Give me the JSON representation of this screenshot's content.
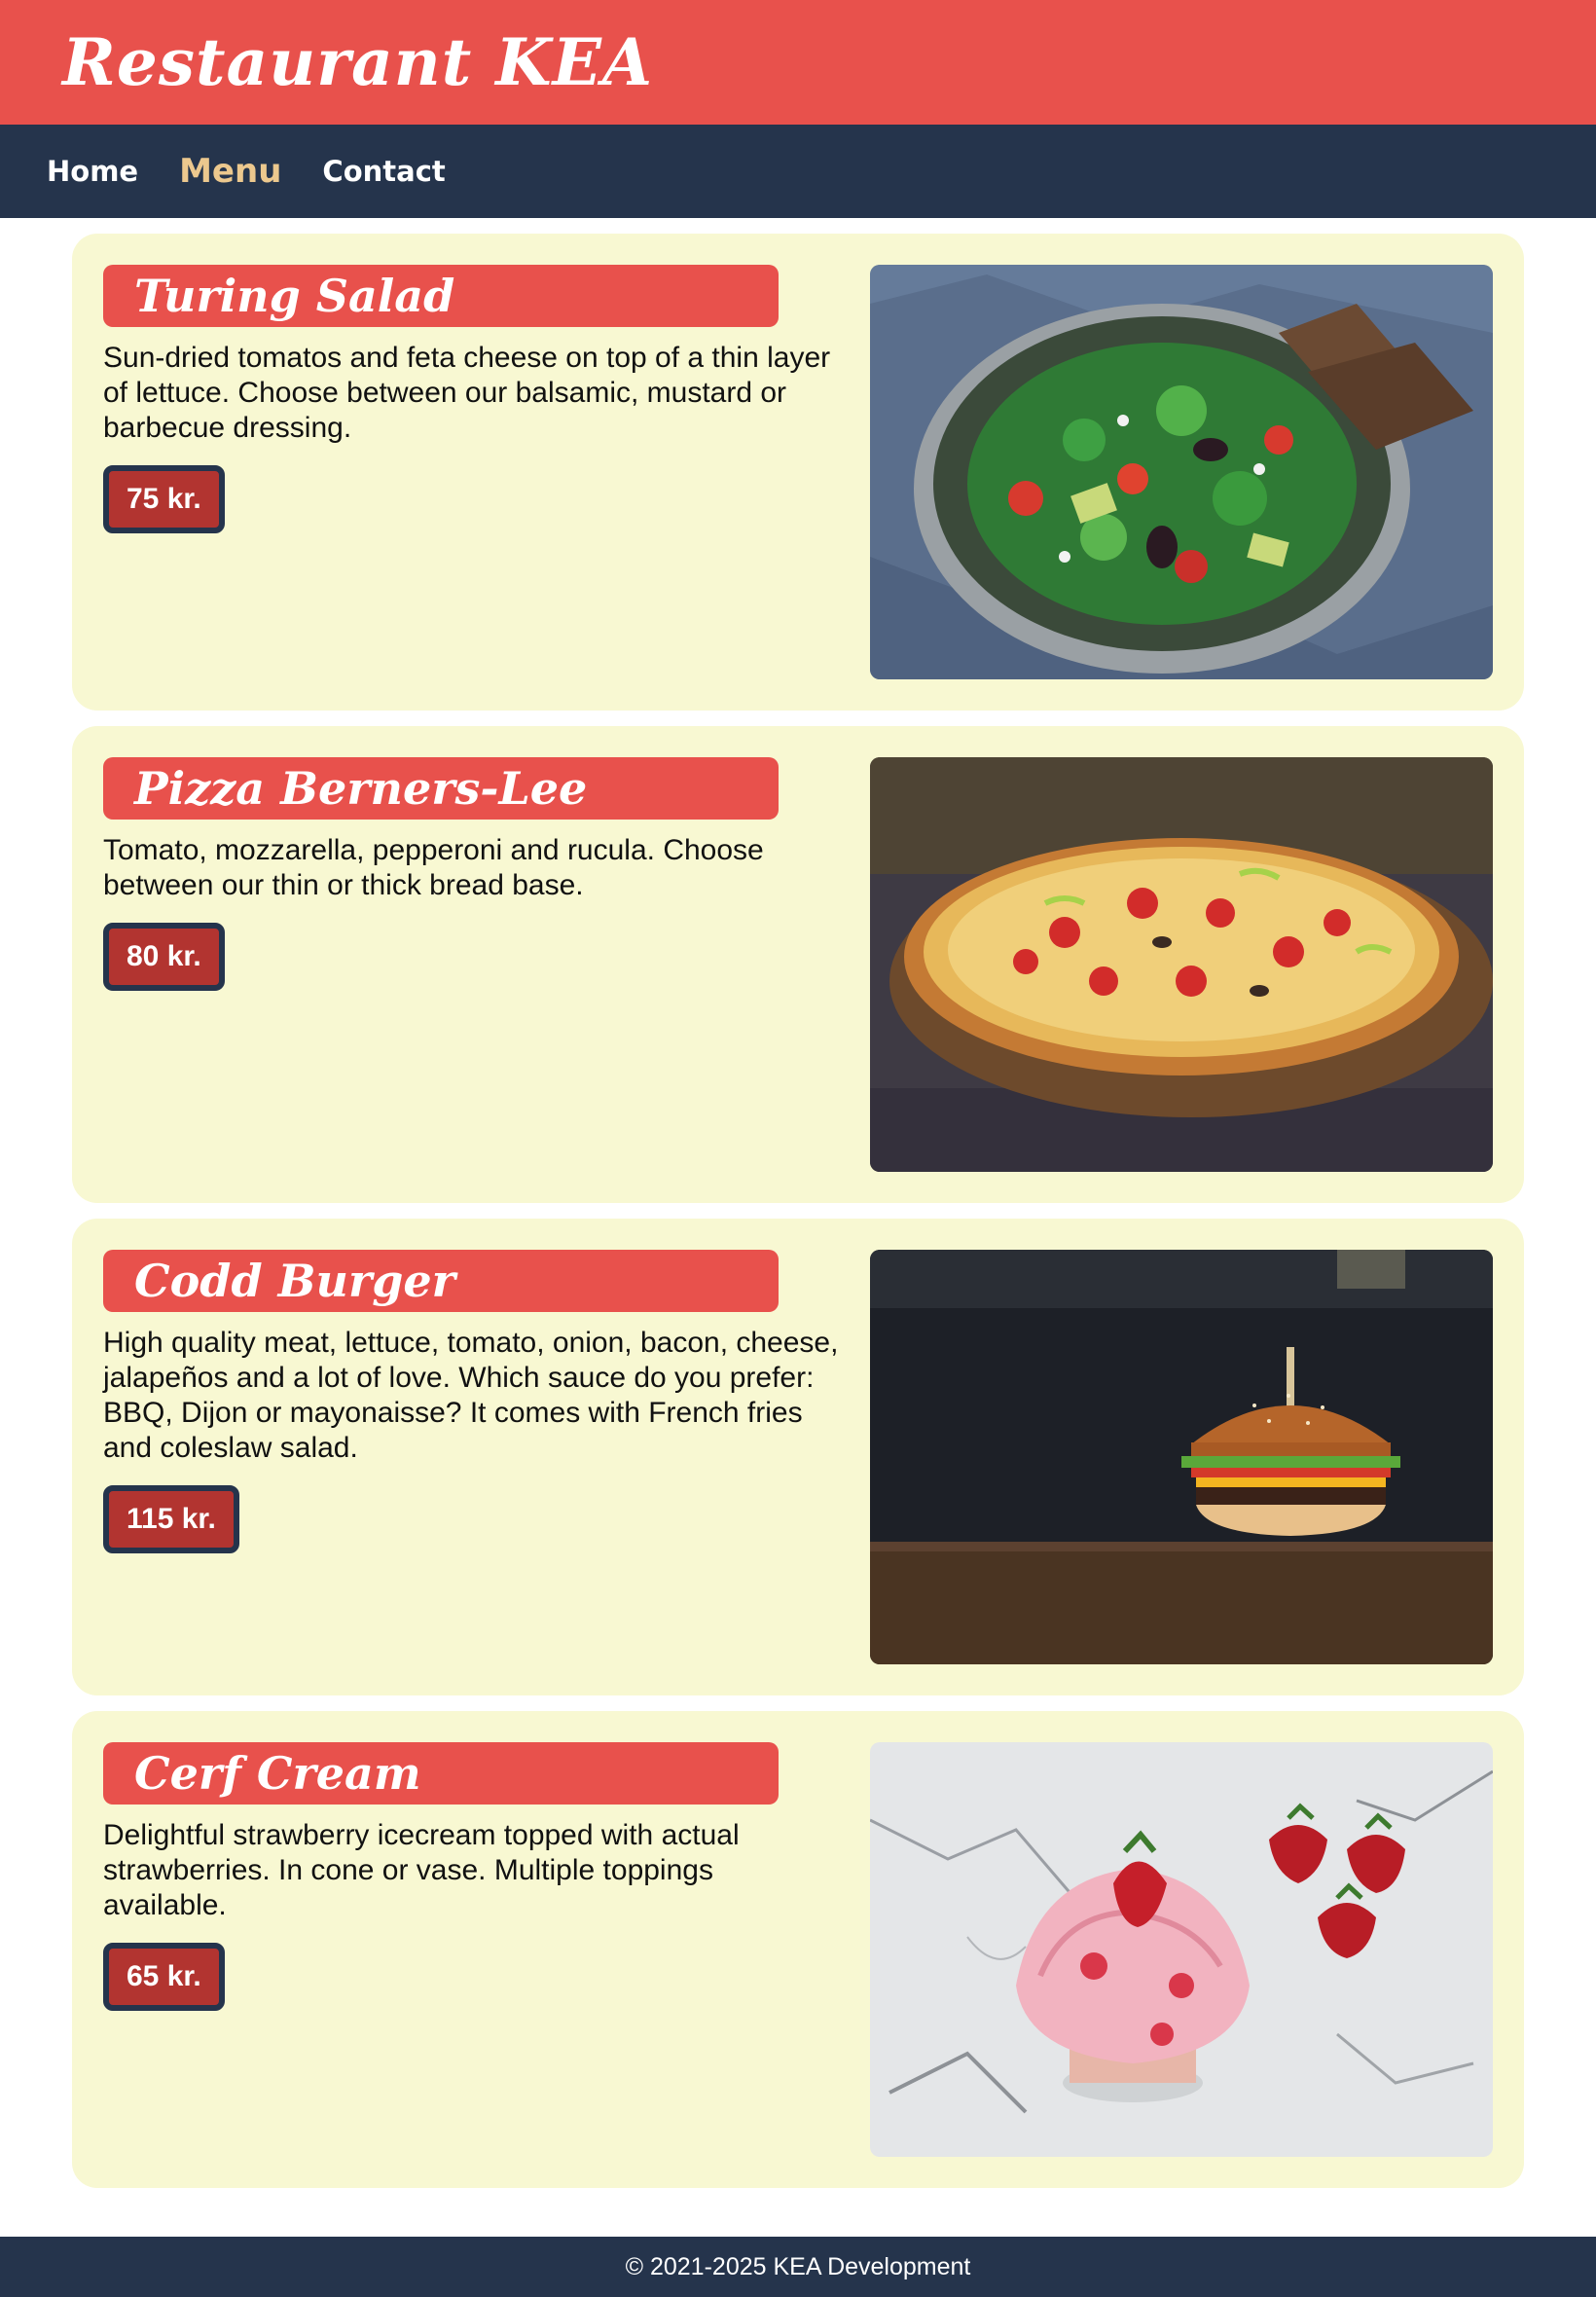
{
  "header": {
    "title": "Restaurant KEA"
  },
  "nav": {
    "items": [
      {
        "label": "Home"
      },
      {
        "label": "Menu",
        "active": true
      },
      {
        "label": "Contact"
      }
    ]
  },
  "menu": {
    "items": [
      {
        "title": "Turing Salad",
        "description": "Sun-dried tomatos and feta cheese on top of a thin layer of lettuce. Choose between our balsamic, mustard or barbecue dressing.",
        "price": "75 kr.",
        "image": "salad-photo"
      },
      {
        "title": "Pizza Berners-Lee",
        "description": "Tomato, mozzarella, pepperoni and rucula. Choose between our thin or thick bread base.",
        "price": "80 kr.",
        "image": "pizza-photo"
      },
      {
        "title": "Codd Burger",
        "description": "High quality meat, lettuce, tomato, onion, bacon, cheese, jalapeños and a lot of love. Which sauce do you prefer: BBQ, Dijon or mayonaisse? It comes with French fries and coleslaw salad.",
        "price": "115 kr.",
        "image": "burger-photo"
      },
      {
        "title": "Cerf Cream",
        "description": "Delightful strawberry icecream topped with actual strawberries. In cone or vase. Multiple toppings available.",
        "price": "65 kr.",
        "image": "icecream-photo"
      }
    ]
  },
  "footer": {
    "text": "© 2021-2025 KEA Development"
  },
  "colors": {
    "header_red": "#e8514c",
    "navy": "#25344c",
    "card_cream": "#f8f8d2",
    "active_nav": "#ecc88e",
    "price_red": "#b23430"
  }
}
